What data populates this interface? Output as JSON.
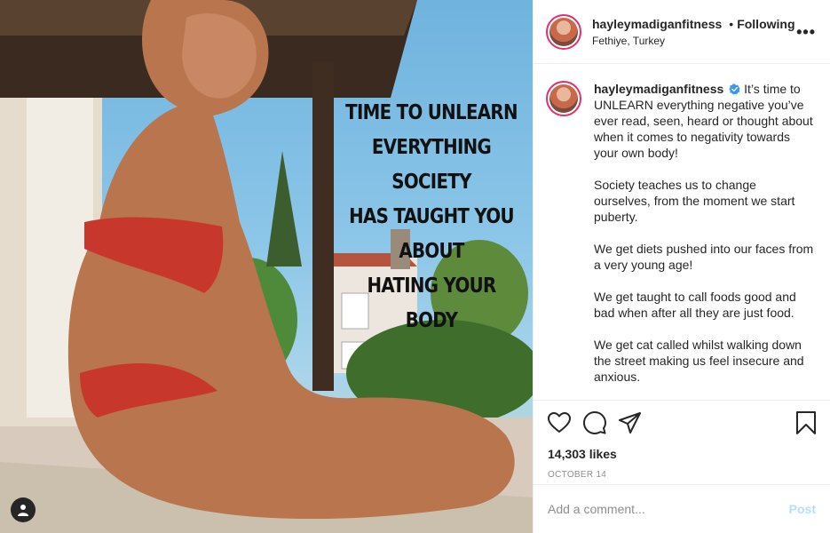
{
  "post": {
    "overlay_lines": [
      "TIME TO UNLEARN",
      "EVERYTHING SOCIETY",
      "HAS TAUGHT YOU ABOUT",
      "HATING YOUR BODY"
    ],
    "user_tag_icon": "user-silhouette-icon"
  },
  "header": {
    "username": "hayleymadiganfitness",
    "separator": "•",
    "follow_status": "Following",
    "location": "Fethiye, Turkey",
    "more_label": "•••"
  },
  "caption": {
    "username": "hayleymadiganfitness",
    "verified_icon": "verified-badge-icon",
    "paragraphs": [
      "It’s time to UNLEARN everything negative you’ve ever read, seen, heard or thought about when it comes to negativity towards your own body!",
      "Society teaches us to change ourselves, from the moment we start puberty.",
      "We get diets pushed into our faces from a very young age!",
      "We get taught to call foods good and bad when after all they are just food.",
      "We get cat called whilst walking down the street making us feel insecure and anxious."
    ]
  },
  "actions": {
    "icons": [
      "heart-icon",
      "comment-icon",
      "share-icon",
      "bookmark-icon"
    ],
    "likes": "14,303 likes",
    "date": "OCTOBER 14"
  },
  "comment": {
    "placeholder": "Add a comment...",
    "post_label": "Post"
  },
  "colors": {
    "text": "#262626",
    "muted": "#8e8e8e",
    "post_disabled": "#b2dffc",
    "border": "#efefef",
    "verified": "#3897f0"
  }
}
